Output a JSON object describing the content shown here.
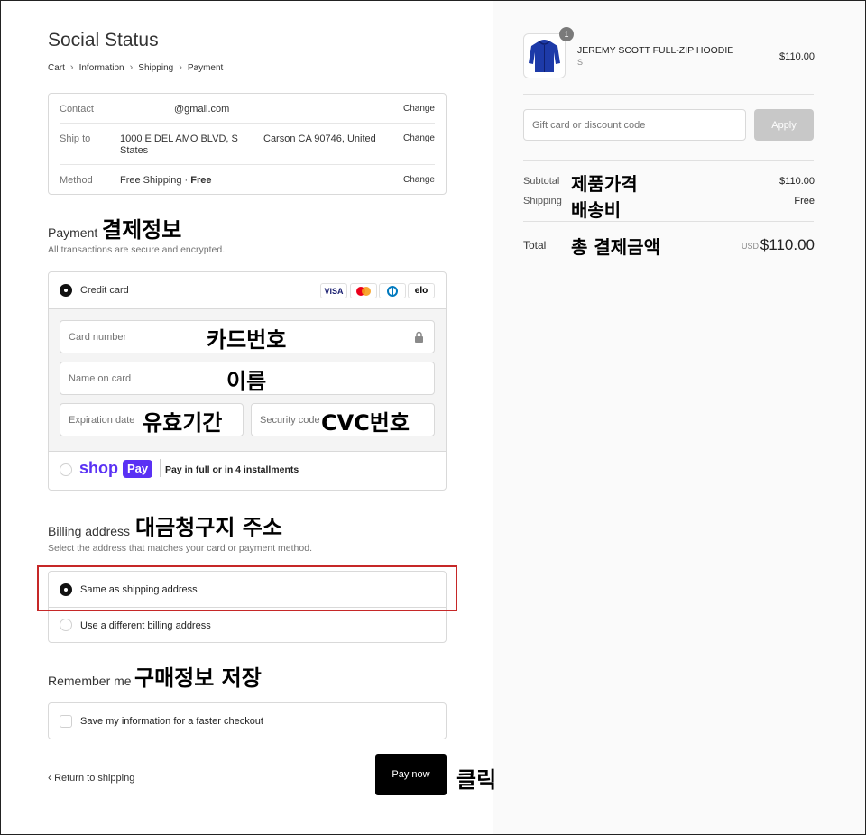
{
  "shop": {
    "title": "Social Status"
  },
  "breadcrumb": [
    "Cart",
    "Information",
    "Shipping",
    "Payment"
  ],
  "review": {
    "contact_label": "Contact",
    "contact_value": "@gmail.com",
    "ship_label": "Ship to",
    "ship_line1": "1000 E DEL AMO BLVD, S",
    "ship_line2": "States",
    "ship_city": "Carson CA 90746, United",
    "method_label": "Method",
    "method_value": "Free Shipping · ",
    "method_price": "Free",
    "change_label": "Change"
  },
  "payment": {
    "title": "Payment",
    "title_ko": "결제정보",
    "subtitle": "All transactions are secure and encrypted.",
    "credit_card_label": "Credit card",
    "brands": [
      "VISA",
      "",
      "",
      "elo"
    ],
    "card_number_placeholder": "Card number",
    "card_number_ko": "카드번호",
    "name_placeholder": "Name on card",
    "name_ko": "이름",
    "expiry_placeholder": "Expiration date",
    "expiry_ko": "유효기간",
    "security_placeholder": "Security code",
    "security_ko": "CVC번호",
    "shoppay_shop": "shop",
    "shoppay_pay": "Pay",
    "shoppay_text": "Pay in full or in 4 installments"
  },
  "billing": {
    "title": "Billing address",
    "title_ko": "대금청구지 주소",
    "subtitle": "Select the address that matches your card or payment method.",
    "same_label": "Same as shipping address",
    "different_label": "Use a different billing address"
  },
  "remember": {
    "title": "Remember me",
    "title_ko": "구매정보 저장",
    "save_label": "Save my information for a faster checkout"
  },
  "footer": {
    "return_label": "Return to shipping",
    "pay_label": "Pay now",
    "click_ko": "클릭"
  },
  "order": {
    "quantity": "1",
    "product_name": "JEREMY SCOTT FULL-ZIP HOODIE",
    "variant": "S",
    "product_price": "$110.00",
    "discount_placeholder": "Gift card or discount code",
    "apply_label": "Apply",
    "subtotal_label": "Subtotal",
    "subtotal_ko": "제품가격",
    "subtotal_value": "$110.00",
    "shipping_label": "Shipping",
    "shipping_ko": "배송비",
    "shipping_value": "Free",
    "total_label": "Total",
    "total_ko": "총 결제금액",
    "currency": "USD",
    "total_value": "$110.00"
  },
  "colors": {
    "highlight": "#c62828",
    "shoppay": "#5a31f4",
    "button": "#000000"
  }
}
